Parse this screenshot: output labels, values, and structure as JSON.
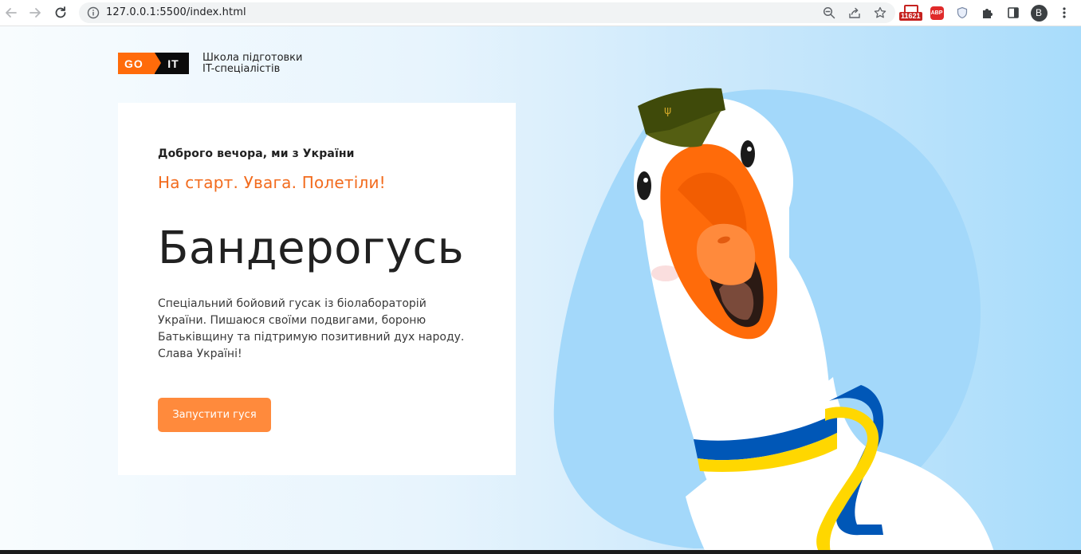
{
  "browser": {
    "url": "127.0.0.1:5500/index.html",
    "extension_badge": "11621",
    "adblock_label": "ABP",
    "profile_initial": "B",
    "icons": [
      "back-arrow-icon",
      "forward-arrow-icon",
      "reload-icon",
      "info-icon",
      "zoom-icon",
      "share-icon",
      "star-icon",
      "gmail-icon",
      "adblock-icon",
      "shield-icon",
      "puzzle-icon",
      "side-panel-icon",
      "menu-dots-icon"
    ]
  },
  "logo": {
    "go": "GO",
    "it": "IT",
    "line1": "Школа підготовки",
    "line2": "IT-спеціалістів"
  },
  "hero": {
    "greeting": "Доброго вечора, ми з України",
    "tagline": "На старт. Увага. Полетіли!",
    "title": "Бандерогусь",
    "description": "Спеціальний бойовий гусак із біолабораторій України. Пишаюся своїми подвигами, бороню Батьківщину та підтримую позитивний дух народу. Слава Україні!",
    "button_label": "Запустити гуся"
  },
  "colors": {
    "accent": "#f26b1d",
    "button": "#ff8a3c",
    "brand_orange": "#ff6b0a",
    "flag_blue": "#0057b7",
    "flag_yellow": "#ffd700"
  }
}
